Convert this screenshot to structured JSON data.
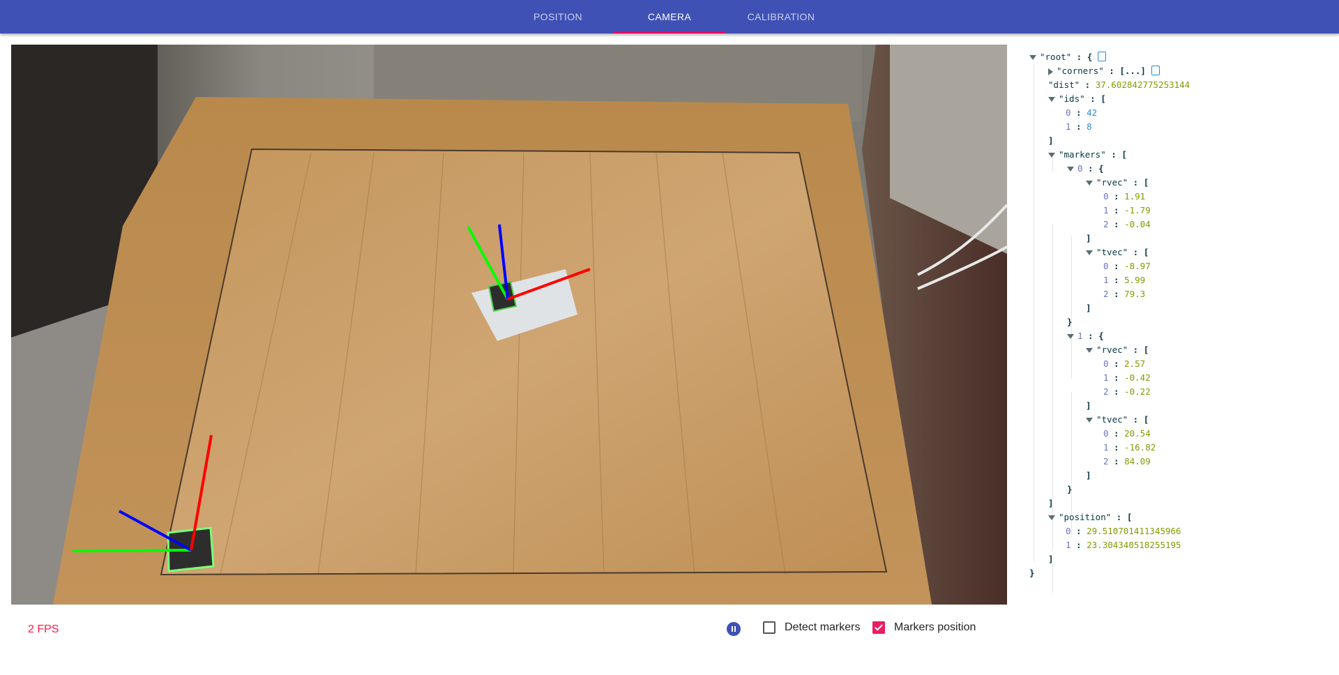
{
  "nav": {
    "tabs": [
      {
        "label": "POSITION",
        "active": false
      },
      {
        "label": "CAMERA",
        "active": true
      },
      {
        "label": "CALIBRATION",
        "active": false
      }
    ],
    "accent": "#3f51b5",
    "indicator_color": "#f50057"
  },
  "status": {
    "fps_label": "2 FPS",
    "fps_color": "#ff1744"
  },
  "controls": {
    "pause_icon": "pause-icon",
    "detect_markers": {
      "label": "Detect markers",
      "checked": false
    },
    "markers_position": {
      "label": "Markers position",
      "checked": true
    },
    "check_color": "#e91e63"
  },
  "json_viewer": {
    "root_key": "\"root\"",
    "corners_key": "\"corners\"",
    "corners_collapsed": "[...]",
    "dist_key": "\"dist\"",
    "dist": "37.602842775253144",
    "ids_key": "\"ids\"",
    "ids": [
      "42",
      "8"
    ],
    "markers_key": "\"markers\"",
    "rvec_key": "\"rvec\"",
    "tvec_key": "\"tvec\"",
    "markers": [
      {
        "rvec": [
          "1.91",
          "-1.79",
          "-0.04"
        ],
        "tvec": [
          "-8.97",
          "5.99",
          "79.3"
        ]
      },
      {
        "rvec": [
          "2.57",
          "-0.42",
          "-0.22"
        ],
        "tvec": [
          "20.54",
          "-16.82",
          "84.09"
        ]
      }
    ],
    "position_key": "\"position\"",
    "position": [
      "29.510701411345966",
      "23.304340518255195"
    ]
  }
}
